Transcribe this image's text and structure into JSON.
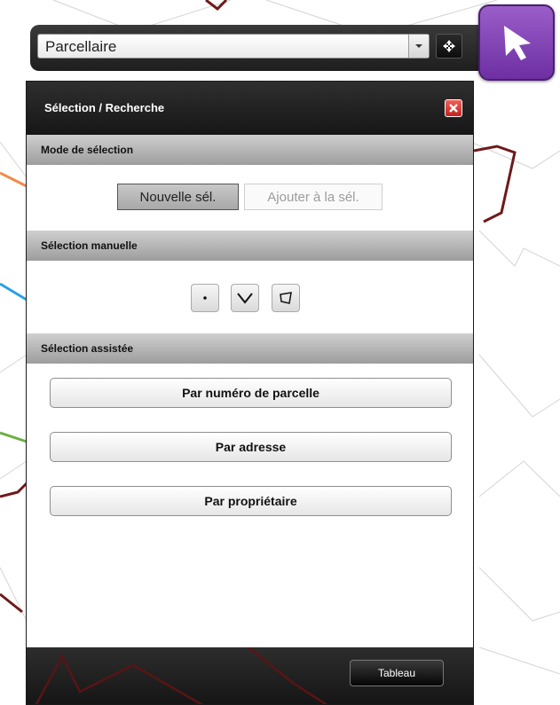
{
  "layer_select": {
    "value": "Parcellaire"
  },
  "icons": {
    "dropdown": "chevron-down-icon",
    "config": "settings-arrows-icon",
    "tool": "cursor-arrow-icon",
    "close": "close-icon",
    "point": "point-icon",
    "line": "line-icon",
    "polygon": "polygon-icon"
  },
  "colors": {
    "tool_button": "#7a3ab0",
    "close_button": "#d8302a",
    "panel_header": "#1f1f1f",
    "parcel_lines": "#6e1a1a"
  },
  "panel": {
    "title": "Sélection / Recherche",
    "sections": {
      "mode": {
        "title": "Mode de sélection",
        "new_selection": "Nouvelle sél.",
        "add_selection": "Ajouter à la sél."
      },
      "manual": {
        "title": "Sélection manuelle"
      },
      "assisted": {
        "title": "Sélection assistée",
        "buttons": [
          "Par numéro de parcelle",
          "Par adresse",
          "Par propriétaire"
        ]
      }
    },
    "footer": {
      "tableau": "Tableau"
    }
  }
}
